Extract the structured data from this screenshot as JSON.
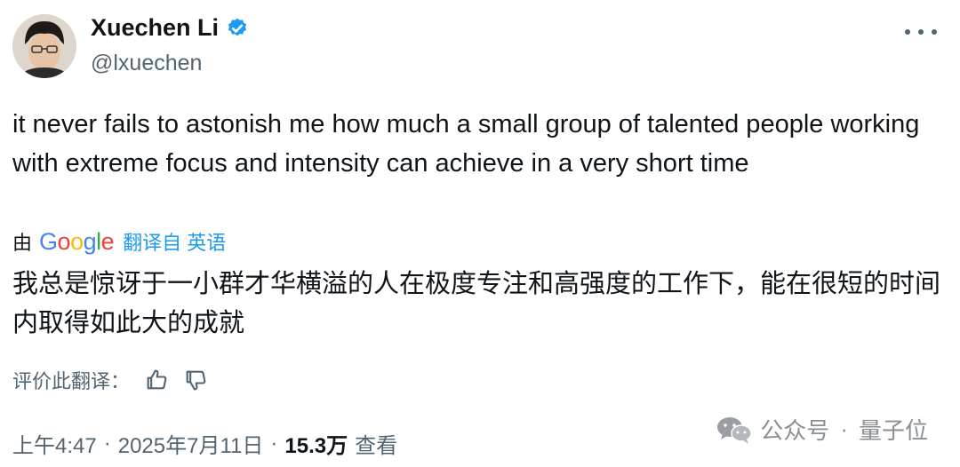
{
  "author": {
    "name": "Xuechen Li",
    "handle": "@lxuechen"
  },
  "tweet": {
    "text": "it never fails to astonish me how much a small group of talented people working with extreme focus and intensity can achieve in a very short time"
  },
  "translation": {
    "by_prefix": "由",
    "provider": "Google",
    "link_text": "翻译自 英语",
    "text": "我总是惊讶于一小群才华横溢的人在极度专注和高强度的工作下，能在很短的时间内取得如此大的成就",
    "rate_label": "评价此翻译："
  },
  "meta": {
    "time": "上午4:47",
    "separator": "·",
    "date": "2025年7月11日",
    "views": "15.3万",
    "views_label": "查看"
  },
  "watermark": {
    "source": "公众号",
    "separator": "·",
    "name": "量子位"
  },
  "colors": {
    "accent": "#1d9bf0",
    "text": "#0f1419",
    "muted": "#536471"
  },
  "icons": [
    "verified-badge-icon",
    "more-icon",
    "thumbs-up-icon",
    "thumbs-down-icon",
    "wechat-icon"
  ]
}
